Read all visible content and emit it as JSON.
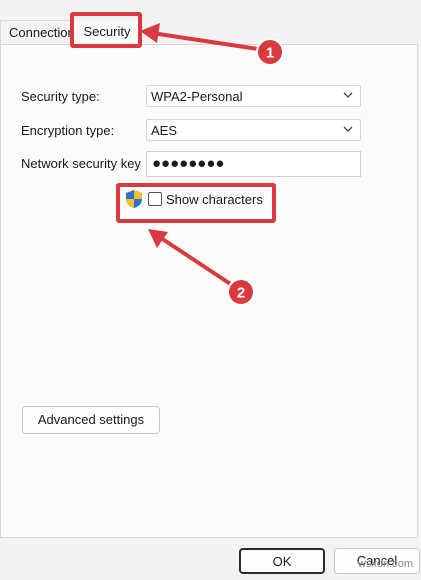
{
  "tabs": {
    "connection": "Connection",
    "security": "Security"
  },
  "form": {
    "security_type_label": "Security type:",
    "security_type_value": "WPA2-Personal",
    "encryption_type_label": "Encryption type:",
    "encryption_type_value": "AES",
    "network_key_label": "Network security key",
    "network_key_value": "●●●●●●●●",
    "show_characters_label": "Show characters",
    "show_characters_checked": false
  },
  "buttons": {
    "advanced": "Advanced settings",
    "ok": "OK",
    "cancel": "Cancel"
  },
  "annotations": {
    "badge_1": "1",
    "badge_2": "2",
    "color": "#d93a3e"
  },
  "watermark": "wsxdn.com",
  "icons": [
    "chevron-down-icon",
    "uac-shield-icon"
  ]
}
